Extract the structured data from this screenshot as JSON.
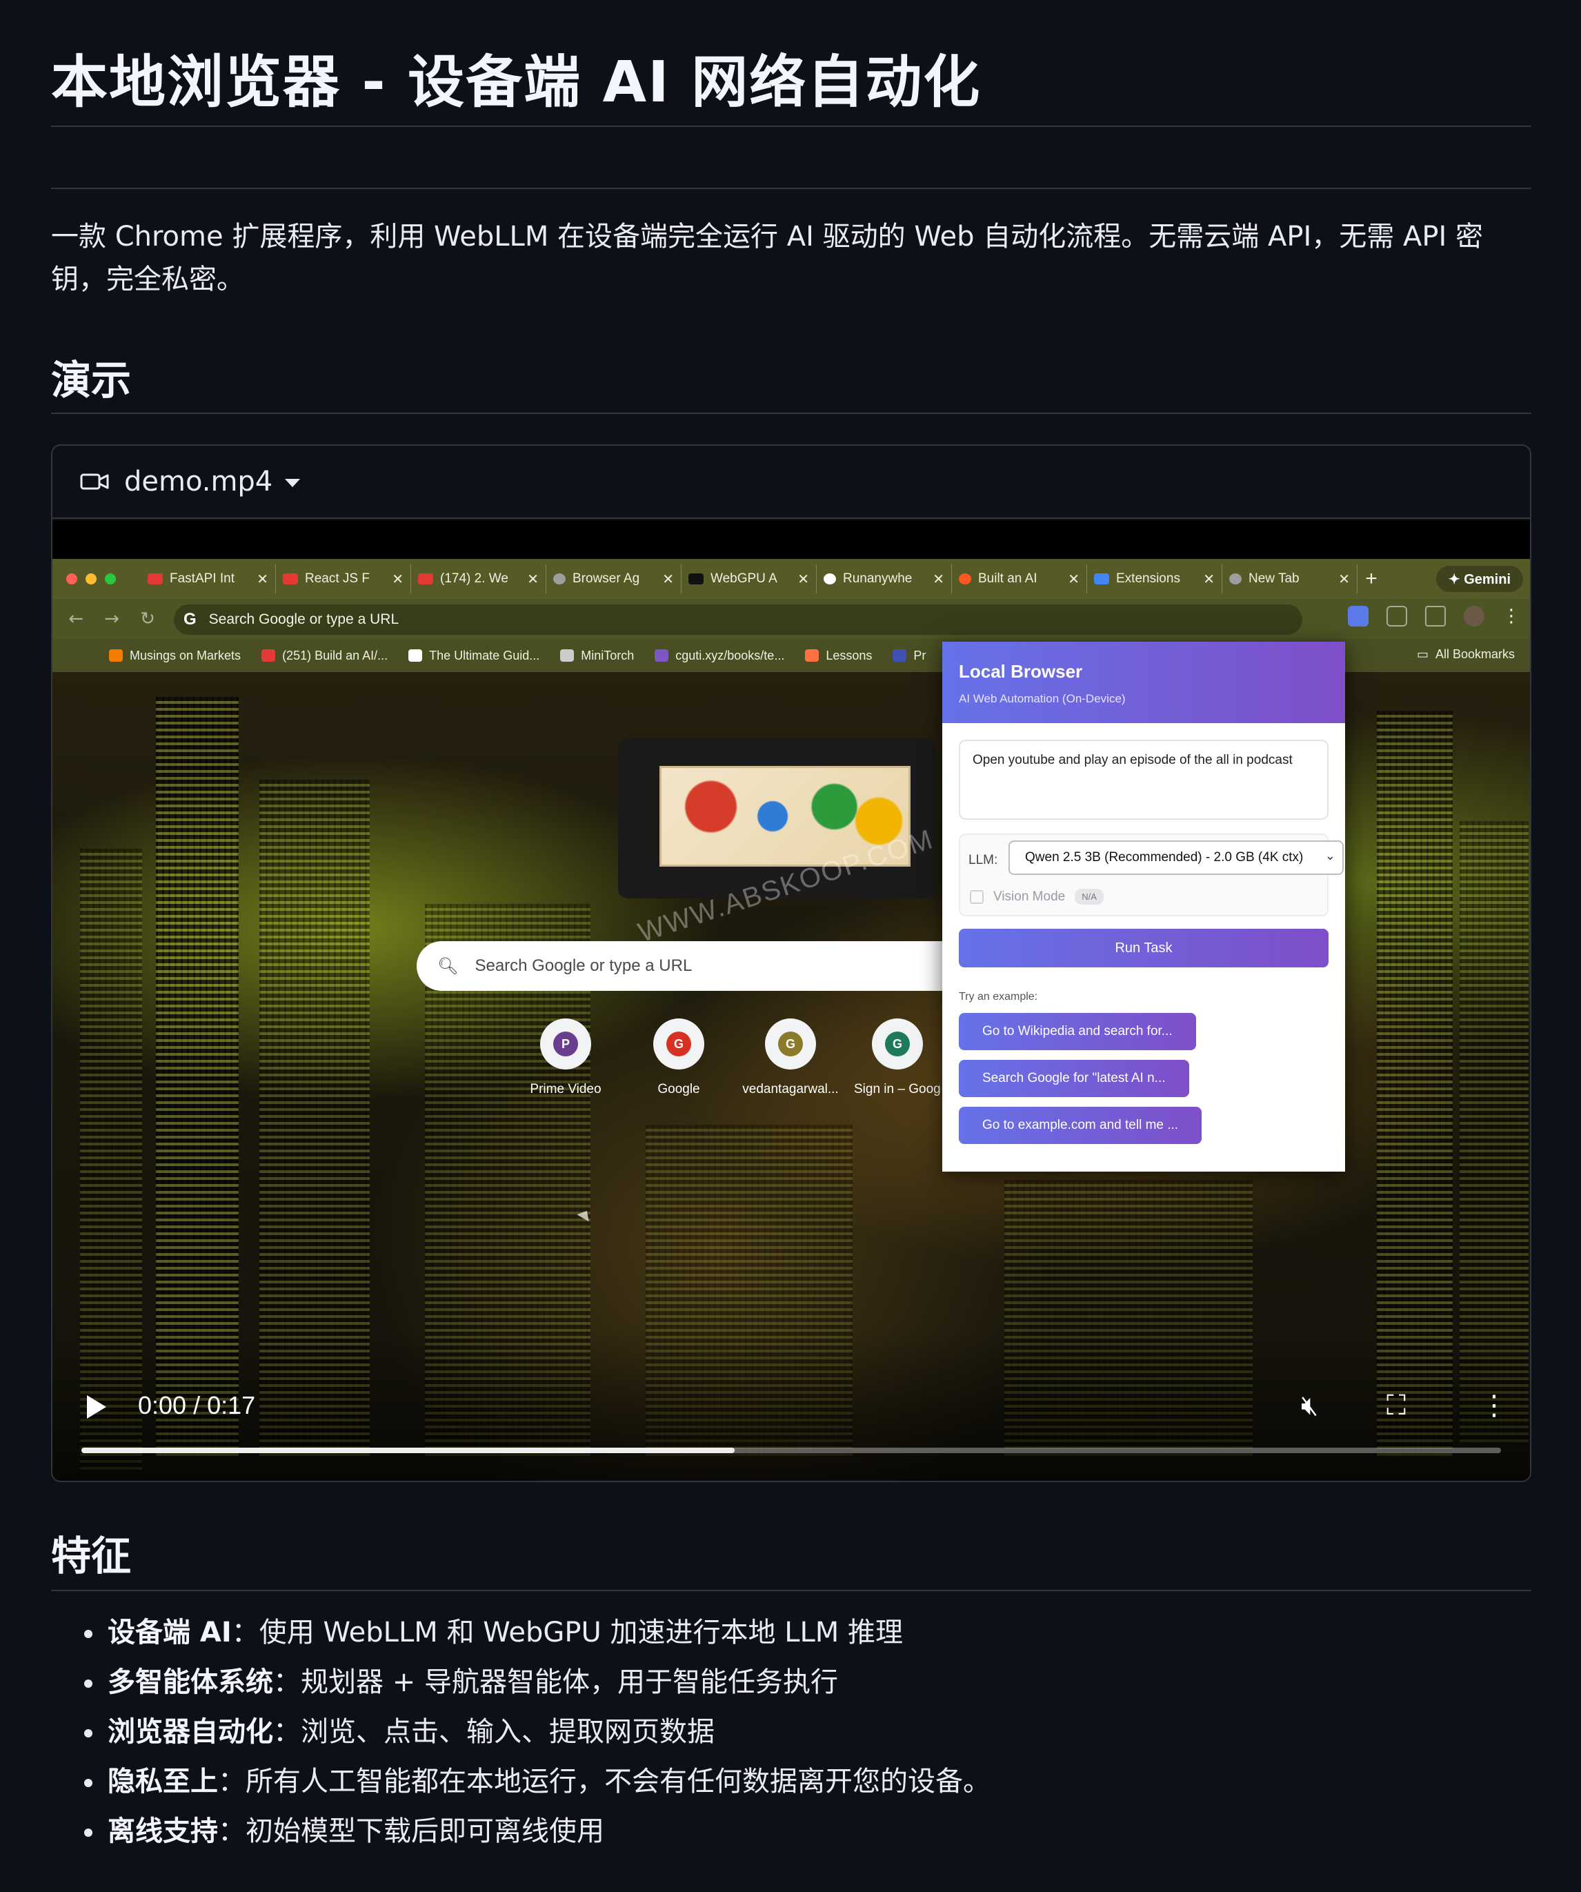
{
  "page": {
    "title": "本地浏览器 - 设备端 AI 网络自动化",
    "description": "一款 Chrome 扩展程序，利用 WebLLM 在设备端完全运行 AI 驱动的 Web 自动化流程。无需云端 API，无需 API 密钥，完全私密。",
    "demo_heading": "演示",
    "features_heading": "特征"
  },
  "video": {
    "filename": "demo.mp4",
    "current_time": "0:00",
    "separator": "/",
    "duration": "0:17",
    "progress_fraction": 0.46
  },
  "browser": {
    "tabs": [
      {
        "label": "FastAPI Int",
        "color": "#e53935"
      },
      {
        "label": "React JS F",
        "color": "#e53935"
      },
      {
        "label": "(174) 2. We",
        "color": "#e53935"
      },
      {
        "label": "Browser Ag",
        "color": "#9e9e9e"
      },
      {
        "label": "WebGPU A",
        "color": "#111111"
      },
      {
        "label": "Runanywhe",
        "color": "#ffffff"
      },
      {
        "label": "Built an AI",
        "color": "#ff5722"
      },
      {
        "label": "Extensions",
        "color": "#4285f4"
      },
      {
        "label": "New Tab",
        "color": "#9e9e9e"
      }
    ],
    "new_tab": "+",
    "gemini": "✦ Gemini",
    "omnibox_placeholder": "Search Google or type a URL",
    "bookmarks": [
      {
        "label": "Musings on Markets",
        "color": "#f57c00"
      },
      {
        "label": "(251) Build an AI/...",
        "color": "#e53935"
      },
      {
        "label": "The Ultimate Guid...",
        "color": "#ffffff"
      },
      {
        "label": "MiniTorch",
        "color": "#cccccc"
      },
      {
        "label": "cguti.xyz/books/te...",
        "color": "#7e57c2"
      },
      {
        "label": "Lessons",
        "color": "#ff7043"
      },
      {
        "label": "Pr",
        "color": "#3f51b5"
      }
    ],
    "all_bookmarks": "All Bookmarks",
    "google_search_placeholder": "Search Google or type a URL",
    "watermark": "WWW.ABSKOOP.COM",
    "shortcuts": [
      {
        "label": "Prime Video",
        "letter": "P",
        "color": "#6a3d8f"
      },
      {
        "label": "Google",
        "letter": "G",
        "color": "#d93025"
      },
      {
        "label": "vedantagarwal...",
        "letter": "G",
        "color": "#8a7a2a"
      },
      {
        "label": "Sign in – Goog",
        "letter": "G",
        "color": "#1e7a5a"
      }
    ]
  },
  "extension": {
    "title": "Local Browser",
    "subtitle": "AI Web Automation (On-Device)",
    "task_text": "Open youtube and play an episode of the all in podcast",
    "llm_label": "LLM:",
    "llm_selected": "Qwen 2.5 3B (Recommended) - 2.0 GB (4K ctx)",
    "vision_label": "Vision Mode",
    "vision_badge": "N/A",
    "run_button": "Run Task",
    "try_label": "Try an example:",
    "examples": [
      "Go to Wikipedia and search for...",
      "Search Google for \"latest AI n...",
      "Go to example.com and tell me ..."
    ]
  },
  "features": [
    {
      "term": "设备端 AI",
      "text": "：使用 WebLLM 和 WebGPU 加速进行本地 LLM 推理"
    },
    {
      "term": "多智能体系统",
      "text": "：规划器 + 导航器智能体，用于智能任务执行"
    },
    {
      "term": "浏览器自动化",
      "text": "：浏览、点击、输入、提取网页数据"
    },
    {
      "term": "隐私至上",
      "text": "：所有人工智能都在本地运行，不会有任何数据离开您的设备。"
    },
    {
      "term": "离线支持",
      "text": "：初始模型下载后即可离线使用"
    }
  ]
}
